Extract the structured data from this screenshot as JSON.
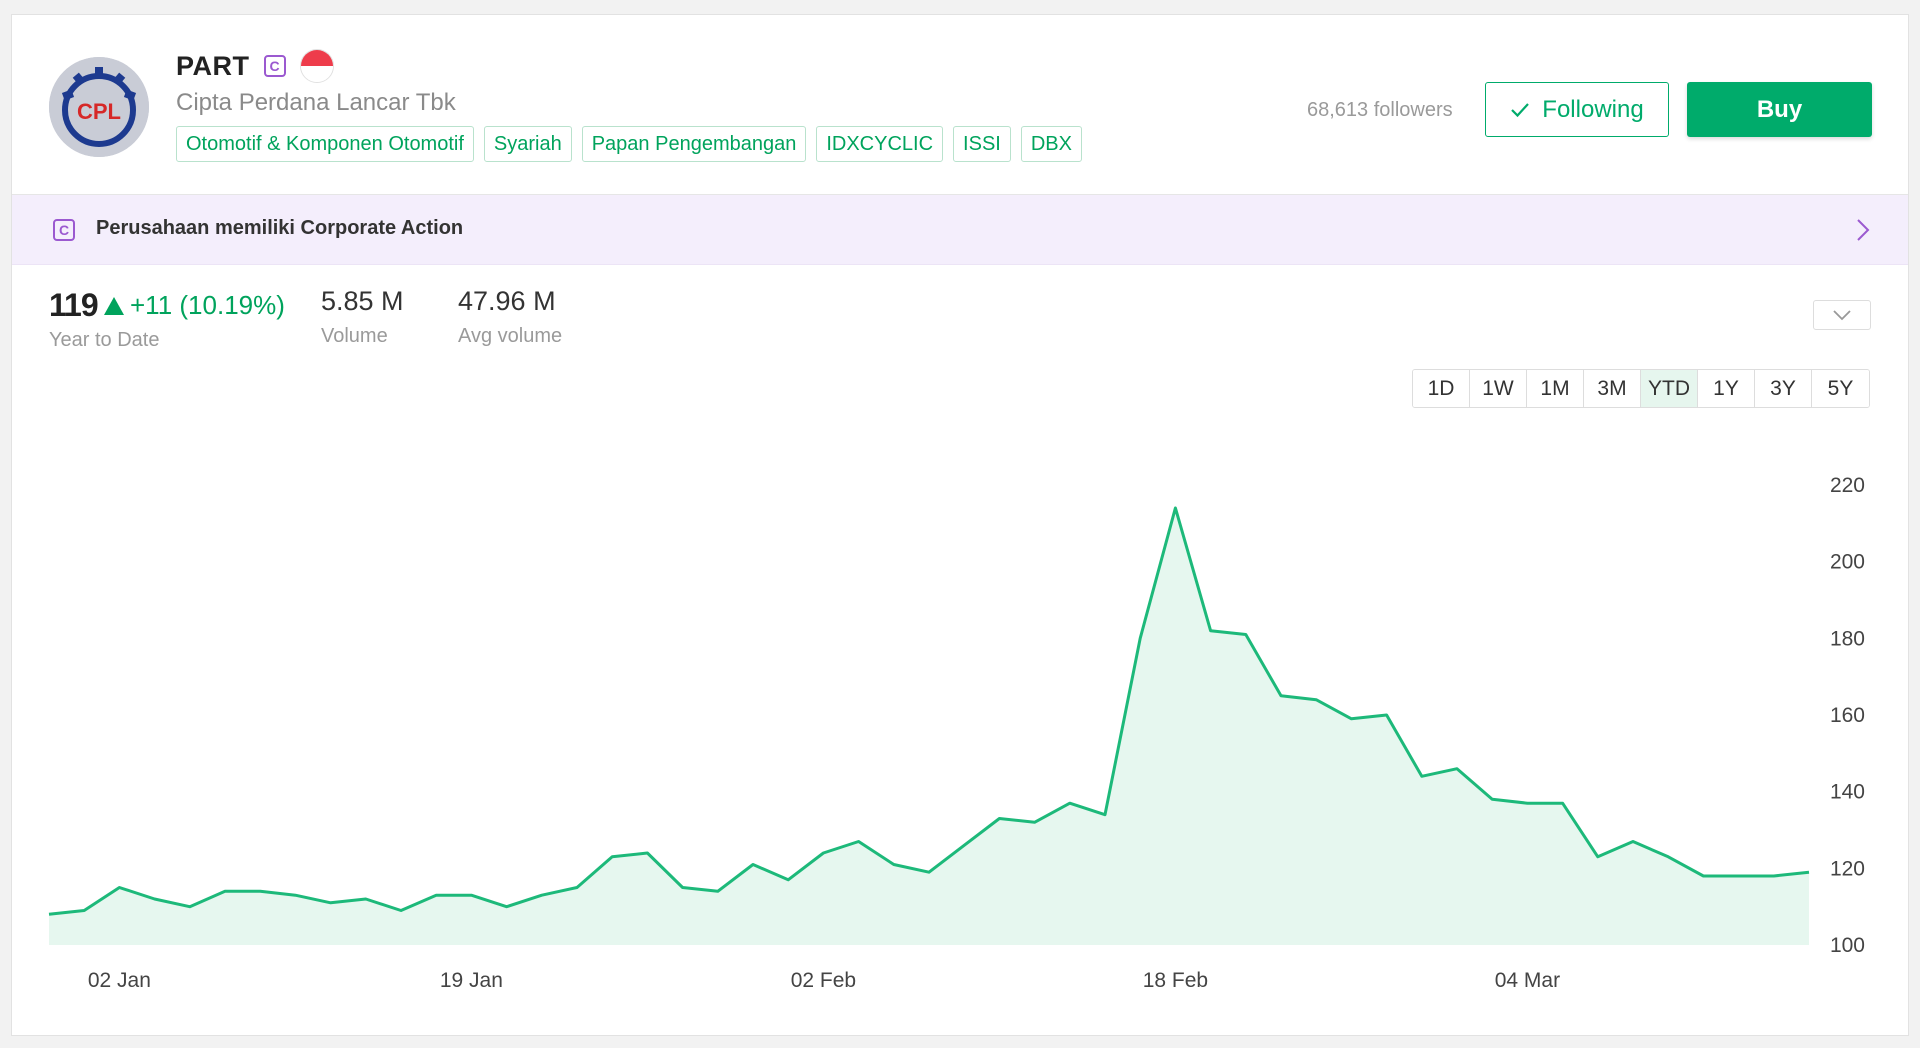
{
  "header": {
    "ticker": "PART",
    "ca_badge": "C",
    "flag": "indonesia-flag",
    "company_name": "Cipta Perdana Lancar Tbk",
    "logo_text": "CPL",
    "tags": [
      "Otomotif & Komponen Otomotif",
      "Syariah",
      "Papan Pengembangan",
      "IDXCYCLIC",
      "ISSI",
      "DBX"
    ],
    "followers": "68,613 followers",
    "following_label": "Following",
    "buy_label": "Buy"
  },
  "banner": {
    "icon": "C",
    "text": "Perusahaan memiliki Corporate Action"
  },
  "stats": {
    "price": "119",
    "change": "+11 (10.19%)",
    "period_label": "Year to Date",
    "volume": "5.85 M",
    "volume_label": "Volume",
    "avg_volume": "47.96 M",
    "avg_volume_label": "Avg volume"
  },
  "ranges": [
    "1D",
    "1W",
    "1M",
    "3M",
    "YTD",
    "1Y",
    "3Y",
    "5Y"
  ],
  "active_range": "YTD",
  "colors": {
    "accent": "#00ab6b",
    "line": "#1db97a",
    "area": "#e6f7ef",
    "purple": "#9b59d0"
  },
  "chart_data": {
    "type": "area",
    "x_ticks": [
      "02 Jan",
      "19 Jan",
      "02 Feb",
      "18 Feb",
      "04 Mar"
    ],
    "x_tick_index": [
      2,
      12,
      22,
      32,
      42
    ],
    "y_ticks": [
      100,
      120,
      140,
      160,
      180,
      200,
      220
    ],
    "ylim": [
      100,
      220
    ],
    "values": [
      108,
      109,
      115,
      112,
      110,
      114,
      114,
      113,
      111,
      112,
      109,
      113,
      113,
      110,
      113,
      115,
      123,
      124,
      115,
      114,
      121,
      117,
      124,
      127,
      121,
      119,
      126,
      133,
      132,
      137,
      134,
      180,
      214,
      182,
      181,
      165,
      164,
      159,
      160,
      144,
      146,
      138,
      137,
      137,
      123,
      127,
      123,
      118,
      118,
      118,
      119
    ]
  }
}
